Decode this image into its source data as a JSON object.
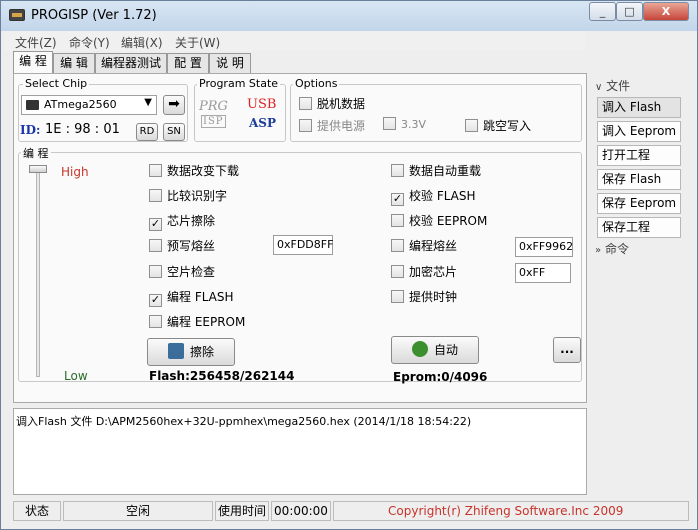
{
  "window": {
    "title": "PROGISP (Ver 1.72)",
    "buttons": {
      "min": "_",
      "max": "□",
      "close": "X"
    }
  },
  "menu": [
    "文件(Z)",
    "命令(Y)",
    "编辑(X)",
    "关于(W)"
  ],
  "tabs": [
    "编 程",
    "编 辑",
    "编程器测试",
    "配 置",
    "说 明"
  ],
  "chip": {
    "group_label": "Select Chip",
    "selected": "ATmega2560",
    "id_label": "ID:",
    "id_value": "1E : 98 : 01",
    "rd": "RD",
    "sn": "SN"
  },
  "program_state": {
    "label": "Program State",
    "prg_text": "PRG",
    "isp_text": "ISP",
    "usb_text": "USB",
    "asp_text": "ASP"
  },
  "options": {
    "label": "Options",
    "offline": "脱机数据",
    "power": "提供电源",
    "v33": "3.3V",
    "skip_empty": "跳空写入"
  },
  "program": {
    "label": "编 程",
    "high": "High",
    "low": "Low",
    "left_checks": [
      {
        "label": "数据改变下载",
        "checked": false
      },
      {
        "label": "比较识别字",
        "checked": false
      },
      {
        "label": "芯片擦除",
        "checked": true
      },
      {
        "label": "预写熔丝",
        "checked": false
      },
      {
        "label": "空片检查",
        "checked": false
      },
      {
        "label": "编程 FLASH",
        "checked": true
      },
      {
        "label": "编程 EEPROM",
        "checked": false
      }
    ],
    "right_checks": [
      {
        "label": "数据自动重载",
        "checked": false
      },
      {
        "label": "校验 FLASH",
        "checked": true
      },
      {
        "label": "校验 EEPROM",
        "checked": false
      },
      {
        "label": "编程熔丝",
        "checked": false
      },
      {
        "label": "加密芯片",
        "checked": false
      },
      {
        "label": "提供时钟",
        "checked": false
      }
    ],
    "prewrite_fuse_value": "0xFDD8FF",
    "fuse_value": "0xFF9962",
    "lock_value": "0xFF",
    "erase_button": "擦除",
    "auto_button": "自动",
    "more_button": "...",
    "flash_info": "Flash:256458/262144",
    "eprom_info": "Eprom:0/4096"
  },
  "log": "调入Flash 文件 D:\\APM2560hex+32U-ppmhex\\mega2560.hex (2014/1/18 18:54:22)",
  "status": {
    "label": "状态",
    "state": "空闲",
    "time_label": "使用时间",
    "time": "00:00:00",
    "copyright": "Copyright(r) Zhifeng Software.Inc 2009"
  },
  "side": {
    "file_header": "文件",
    "cmd_header": "命令",
    "items": [
      "调入 Flash",
      "调入 Eeprom",
      "打开工程",
      "保存 Flash",
      "保存 Eeprom",
      "保存工程"
    ]
  },
  "colors": {
    "accent_red": "#c7342b",
    "id_blue": "#1a34a8"
  }
}
